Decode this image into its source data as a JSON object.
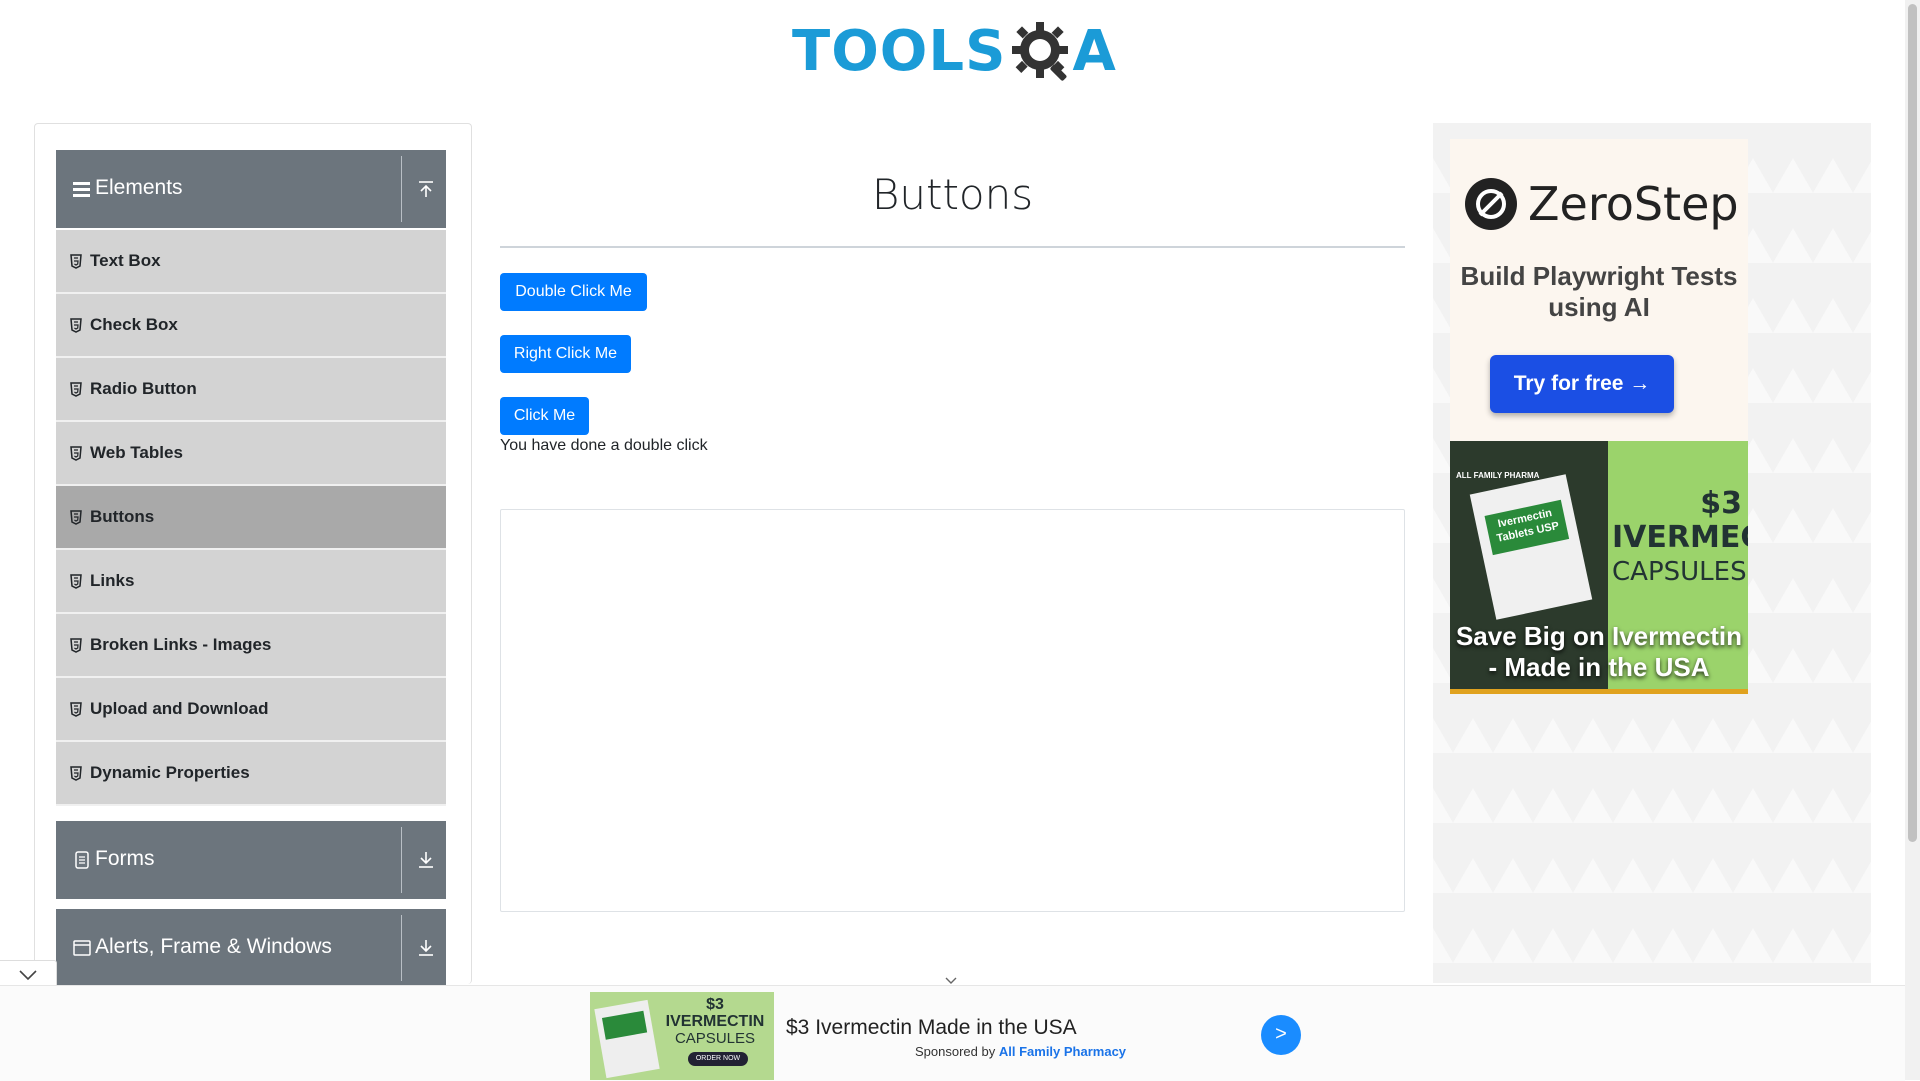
{
  "header": {
    "logo_text": "TOOLS",
    "logo_text_qa": "A"
  },
  "sidebar": {
    "groups": [
      {
        "label": "Elements",
        "expanded": true
      },
      {
        "label": "Forms",
        "expanded": false
      },
      {
        "label": "Alerts, Frame & Windows",
        "expanded": false
      }
    ],
    "items": [
      {
        "label": "Text Box"
      },
      {
        "label": "Check Box"
      },
      {
        "label": "Radio Button"
      },
      {
        "label": "Web Tables"
      },
      {
        "label": "Buttons",
        "active": true
      },
      {
        "label": "Links"
      },
      {
        "label": "Broken Links - Images"
      },
      {
        "label": "Upload and Download"
      },
      {
        "label": "Dynamic Properties"
      }
    ]
  },
  "main": {
    "title": "Buttons",
    "double_click_label": "Double Click Me",
    "right_click_label": "Right Click Me",
    "click_label": "Click Me",
    "message": "You have done a double click"
  },
  "ads": {
    "zerostep": {
      "brand": "ZeroStep",
      "tagline": "Build Playwright Tests using AI",
      "cta": "Try for free →"
    },
    "ivermectin": {
      "brand": "ALL FAMILY PHARMA",
      "box_label": "Ivermectin Tablets USP",
      "price": "$3",
      "product": "IVERMECTIN",
      "form": "CAPSULES",
      "headline": "Save Big on Ivermectin - Made in the USA"
    },
    "banner": {
      "thumb_price": "$3",
      "thumb_product": "IVERMECTIN",
      "thumb_form": "CAPSULES",
      "thumb_cta": "ORDER NOW",
      "headline": "$3 Ivermectin Made in the USA",
      "sponsored_prefix": "Sponsored by",
      "sponsor": "All Family Pharmacy",
      "arrow": ">"
    }
  },
  "colors": {
    "primary_button": "#007bff",
    "sidebar_header": "#6c757d",
    "sidebar_item": "#d3d3d3",
    "sidebar_item_active": "#a9a9a9",
    "logo_blue": "#1b9bd7"
  }
}
